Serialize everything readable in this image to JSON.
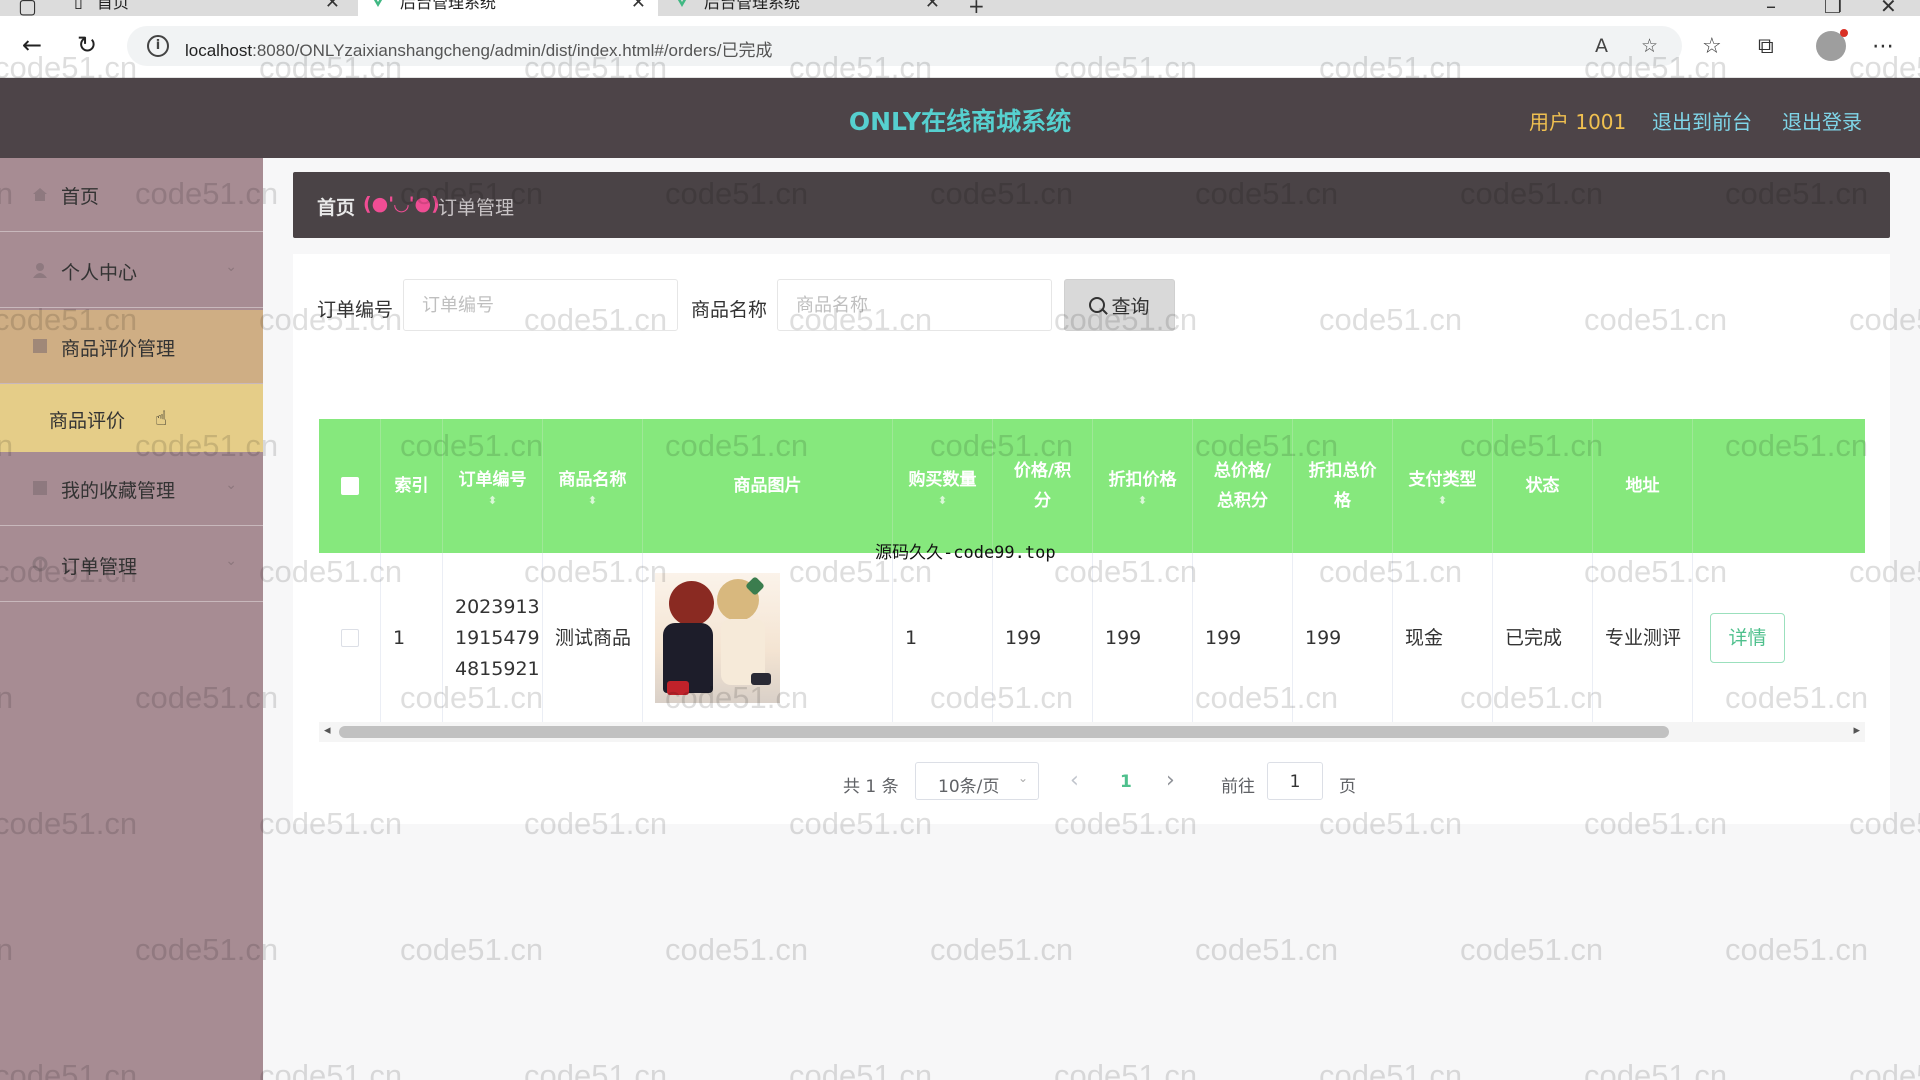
{
  "browser": {
    "tabs": [
      {
        "title": "首页",
        "active": false
      },
      {
        "title": "后台管理系统",
        "active": true
      },
      {
        "title": "后台管理系统",
        "active": false
      }
    ],
    "url_host": "localhost",
    "url_rest": ":8080/ONLYzaixianshangcheng/admin/dist/index.html#/orders/已完成"
  },
  "header": {
    "title": "ONLY在线商城系统",
    "user": "用户 1001",
    "front_link": "退出到前台",
    "logout_link": "退出登录"
  },
  "sidebar": {
    "items": [
      {
        "label": "首页"
      },
      {
        "label": "个人中心"
      },
      {
        "label": "商品评价管理"
      },
      {
        "label": "我的收藏管理"
      },
      {
        "label": "订单管理"
      }
    ],
    "submenu": {
      "label": "商品评价"
    }
  },
  "breadcrumb": {
    "home": "首页",
    "separator": "(●'◡'●)",
    "current": "订单管理"
  },
  "search": {
    "order_no_label": "订单编号",
    "order_no_placeholder": "订单编号",
    "goods_name_label": "商品名称",
    "goods_name_placeholder": "商品名称",
    "button": "查询"
  },
  "table": {
    "columns": [
      {
        "key": "select",
        "label": ""
      },
      {
        "key": "index",
        "label": "索引"
      },
      {
        "key": "order_no",
        "label": "订单编号"
      },
      {
        "key": "goods_name",
        "label": "商品名称"
      },
      {
        "key": "goods_image",
        "label": "商品图片"
      },
      {
        "key": "quantity",
        "label": "购买数量"
      },
      {
        "key": "price",
        "label": "价格/积分"
      },
      {
        "key": "discount_price",
        "label": "折扣价格"
      },
      {
        "key": "total",
        "label": "总价格/总积分"
      },
      {
        "key": "discount_total",
        "label": "折扣总价格"
      },
      {
        "key": "pay_type",
        "label": "支付类型"
      },
      {
        "key": "status",
        "label": "状态"
      },
      {
        "key": "address",
        "label": "地址"
      },
      {
        "key": "action",
        "label": ""
      }
    ],
    "rows": [
      {
        "index": "1",
        "order_no": "2023913 1915479 4815921",
        "goods_name": "测试商品",
        "quantity": "1",
        "price": "199",
        "discount_price": "199",
        "total": "199",
        "discount_total": "199",
        "pay_type": "现金",
        "status": "已完成",
        "address": "专业测评",
        "action": "详情"
      }
    ]
  },
  "overlay_text": "源码久久-code99.top",
  "pagination": {
    "total": "共 1 条",
    "page_size": "10条/页",
    "current": "1",
    "goto_label": "前往",
    "goto_value": "1",
    "page_suffix": "页"
  },
  "watermark": "code51.cn",
  "colors": {
    "header_bg": "#4d4448",
    "title": "#56d0cf",
    "sidebar_bg": "#a78c93",
    "table_header": "#86e87d",
    "accent": "#4fc08d"
  }
}
